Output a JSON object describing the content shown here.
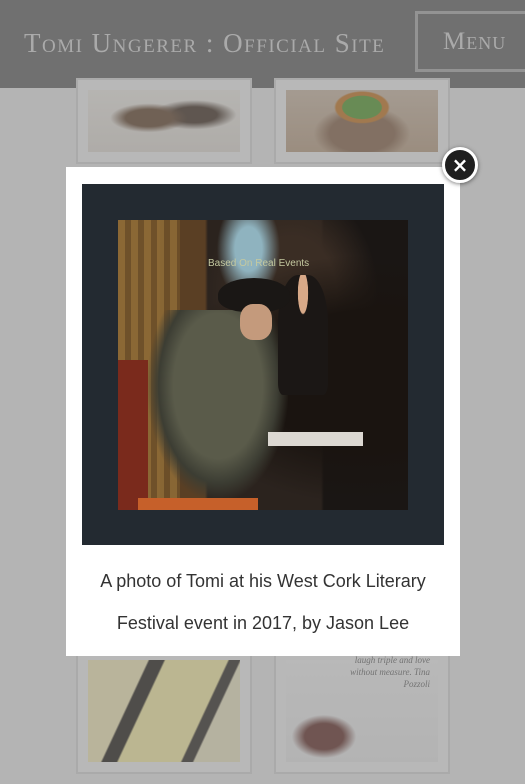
{
  "header": {
    "title": "Tomi Ungerer : Official Site",
    "menu_label": "Menu"
  },
  "grid": {
    "poem_text": "laugh triple and love without measure. Tina Pozzoli"
  },
  "modal": {
    "photo_sign_text": "Based On Real Events",
    "caption": "A photo of Tomi at his West Cork Literary Festival event in 2017, by Jason Lee",
    "close_icon": "×"
  },
  "colors": {
    "header_bg": "#6b6b6b",
    "overlay": "rgba(120,120,120,0.45)",
    "modal_bg": "#ffffff",
    "photo_frame": "#232a31",
    "close_button": "#1f1f1f"
  }
}
